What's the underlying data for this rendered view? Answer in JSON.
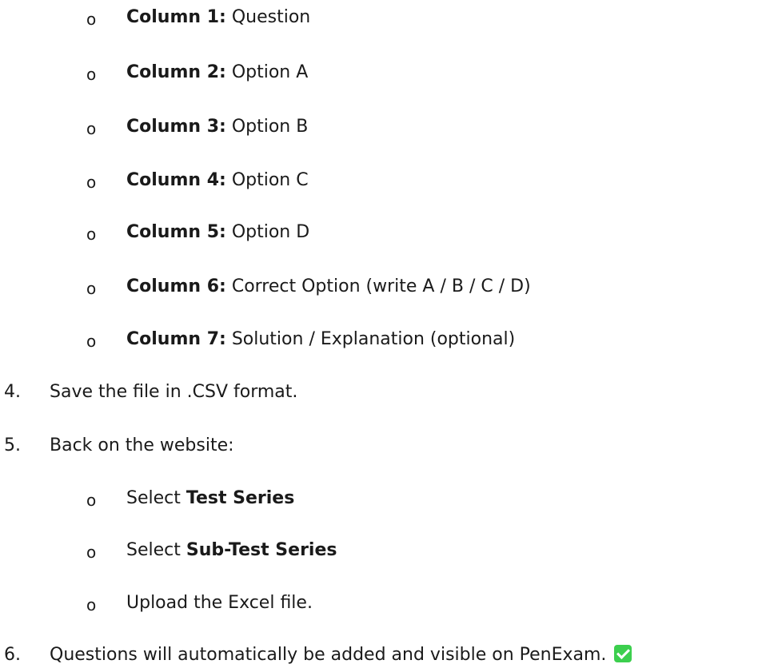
{
  "columns": [
    {
      "label": "Column 1:",
      "value": "Question"
    },
    {
      "label": "Column 2:",
      "value": "Option A"
    },
    {
      "label": "Column 3:",
      "value": "Option B"
    },
    {
      "label": "Column 4:",
      "value": "Option C"
    },
    {
      "label": "Column 5:",
      "value": "Option D"
    },
    {
      "label": "Column 6:",
      "value": "Correct Option (write A / B / C / D)"
    },
    {
      "label": "Column 7:",
      "value": "Solution / Explanation (optional)"
    }
  ],
  "bullet_symbol": "o",
  "steps": {
    "step4": {
      "number": "4.",
      "text": "Save the file in .CSV format."
    },
    "step5": {
      "number": "5.",
      "text": "Back on the website:"
    },
    "step6": {
      "number": "6.",
      "text": "Questions will automatically be added and visible on PenExam."
    }
  },
  "website_items": [
    {
      "prefix": "Select ",
      "bold": "Test Series",
      "suffix": ""
    },
    {
      "prefix": "Select ",
      "bold": "Sub-Test Series",
      "suffix": ""
    },
    {
      "prefix": "Upload the Excel file.",
      "bold": "",
      "suffix": ""
    }
  ],
  "colors": {
    "check_icon": "#3ccf4e",
    "text": "#1a1a1a"
  },
  "icons": {
    "step6_icon": "check-mark-button-icon"
  }
}
